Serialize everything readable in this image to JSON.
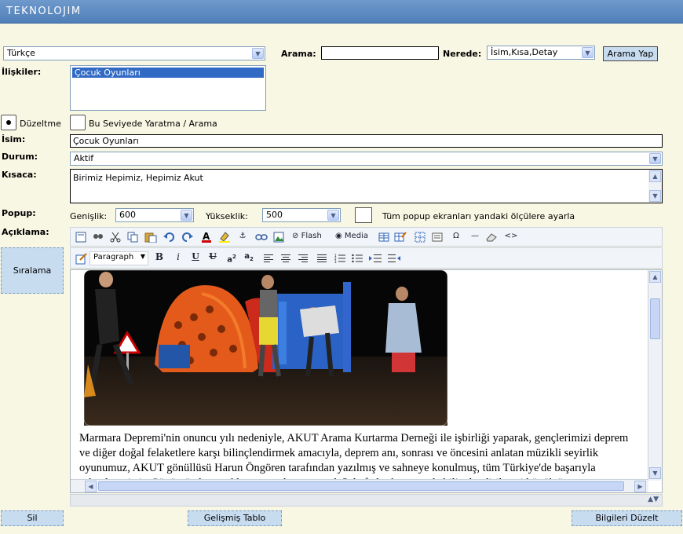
{
  "app": {
    "logo": "TEKNOLOJIM"
  },
  "language": {
    "value": "Türkçe"
  },
  "search": {
    "label": "Arama:",
    "value": "",
    "where_label": "Nerede:",
    "where_value": "İsim,Kısa,Detay",
    "button": "Arama Yap"
  },
  "relations": {
    "label": "İlişkiler:",
    "items": [
      "Çocuk Oyunları"
    ]
  },
  "mode": {
    "edit_label": "Düzeltme",
    "create_label": "Bu Seviyede Yaratma / Arama",
    "selected": "edit"
  },
  "form": {
    "name_label": "İsim:",
    "name_value": "Çocuk Oyunları",
    "status_label": "Durum:",
    "status_value": "Aktif",
    "short_label": "Kısaca:",
    "short_value": "Birimiz Hepimiz, Hepimiz Akut",
    "popup_label": "Popup:",
    "width_label": "Genişlik:",
    "width_value": "600",
    "height_label": "Yükseklik:",
    "height_value": "500",
    "popup_all_label": "Tüm popup ekranları yandaki ölçülere ayarla",
    "desc_label": "Açıklama:"
  },
  "editor": {
    "toolbar1": [
      "new-document-icon",
      "find-icon",
      "cut-icon",
      "copy-icon",
      "paste-icon",
      "undo-icon",
      "redo-icon",
      "text-color-icon",
      "highlight-icon",
      "anchor-icon",
      "link-icon",
      "image-icon"
    ],
    "flash_label": "Flash",
    "media_label": "Media",
    "format_value": "Paragraph",
    "paragraph": "Marmara Depremi'nin onuncu yılı nedeniyle, AKUT Arama Kurtarma Derneği ile işbirliği yaparak, gençlerimizi deprem ve diğer doğal felaketlere karşı bilinçlendirmek amacıyla, deprem anı, sonrası ve öncesini anlatan müzikli seyirlik oyunumuz, AKUT gönüllüsü Harun Öngören tarafından yazılmış ve sahneye konulmuş, tüm Türkiye'de başarıyla sahnelenmiştir. Günümüzde çocuklarımızın deprem ve doğal afetler konusunda bilinçlendirilmesi büyük önem taşımaktadır."
  },
  "buttons": {
    "sort": "Sıralama",
    "delete": "Sil",
    "advanced_table": "Gelişmiş Tablo",
    "save": "Bilgileri Düzelt"
  },
  "colors": {
    "header": "#5a88c2",
    "background": "#f8f7e4",
    "button": "#c8dcf0",
    "selection": "#316ac5"
  }
}
